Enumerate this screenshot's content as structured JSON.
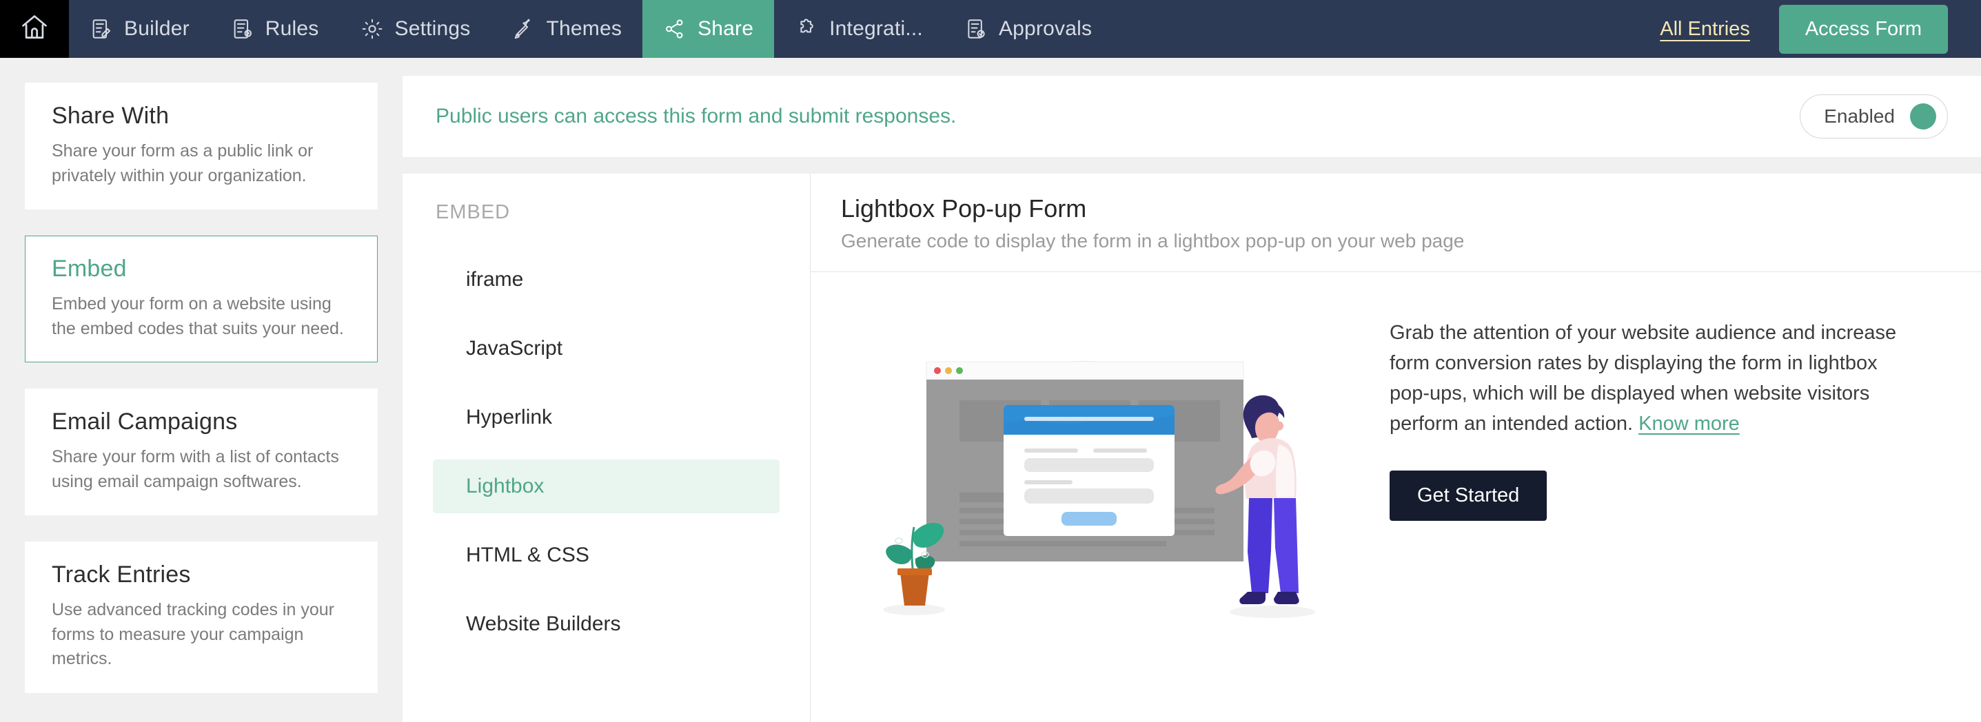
{
  "topnav": {
    "home_icon": "home-icon",
    "items": [
      {
        "label": "Builder",
        "icon": "form-builder-icon",
        "active": false
      },
      {
        "label": "Rules",
        "icon": "rules-document-icon",
        "active": false
      },
      {
        "label": "Settings",
        "icon": "gear-icon",
        "active": false
      },
      {
        "label": "Themes",
        "icon": "paint-roller-icon",
        "active": false
      },
      {
        "label": "Share",
        "icon": "share-nodes-icon",
        "active": true
      },
      {
        "label": "Integrati...",
        "icon": "puzzle-piece-icon",
        "active": false
      },
      {
        "label": "Approvals",
        "icon": "approval-checklist-icon",
        "active": false
      }
    ],
    "all_entries_label": "All Entries",
    "access_form_label": "Access Form",
    "accent_green": "#50a98c",
    "nav_background": "#2d3a55",
    "all_entries_color": "#f4e7b4"
  },
  "sidebar": {
    "items": [
      {
        "title": "Share With",
        "description": "Share your form as a public link or privately within your organization.",
        "selected": false
      },
      {
        "title": "Embed",
        "description": "Embed your form on a website using the embed codes that suits your need.",
        "selected": true
      },
      {
        "title": "Email Campaigns",
        "description": "Share your form with a list of contacts using email campaign softwares.",
        "selected": false
      },
      {
        "title": "Track Entries",
        "description": "Use advanced tracking codes in your forms to measure your campaign metrics.",
        "selected": false
      }
    ]
  },
  "banner": {
    "message": "Public users can access this form and submit responses.",
    "toggle_label": "Enabled",
    "toggle_state": "on",
    "toggle_color": "#50a98c"
  },
  "embed_menu": {
    "section_title": "EMBED",
    "items": [
      {
        "label": "iframe",
        "active": false
      },
      {
        "label": "JavaScript",
        "active": false
      },
      {
        "label": "Hyperlink",
        "active": false
      },
      {
        "label": "Lightbox",
        "active": true
      },
      {
        "label": "HTML & CSS",
        "active": false
      },
      {
        "label": "Website Builders",
        "active": false
      }
    ]
  },
  "detail": {
    "title": "Lightbox Pop-up Form",
    "subtitle": "Generate code to display the form in a lightbox pop-up on your web page",
    "body_text": "Grab the attention of your website audience and increase form conversion rates by displaying the form in lightbox pop-ups, which will be displayed when website visitors perform an intended action.",
    "know_more_label": "Know more",
    "get_started_label": "Get Started",
    "illustration": "lightbox-popup-illustration"
  }
}
